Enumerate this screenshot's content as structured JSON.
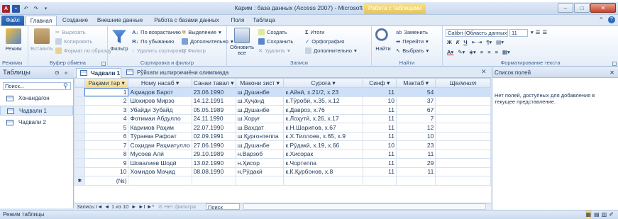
{
  "window": {
    "title": "Карим : база данных (Access 2007)  -  Microsoft Access",
    "context_tab": "Работа с таблицами"
  },
  "ribbon_tabs": [
    "Файл",
    "Главная",
    "Создание",
    "Внешние данные",
    "Работа с базами данных",
    "Поля",
    "Таблица"
  ],
  "ribbon": {
    "views": {
      "label": "Режимы",
      "button": "Режим"
    },
    "clipboard": {
      "label": "Буфер обмена",
      "paste": "Вставить",
      "cut": "Вырезать",
      "copy": "Копировать",
      "format_painter": "Формат по образцу"
    },
    "sort_filter": {
      "label": "Сортировка и фильтр",
      "filter": "Фильтр",
      "asc": "По возрастанию",
      "desc": "По убыванию",
      "remove_sort": "Удалить сортировку",
      "selection": "Выделение",
      "advanced": "Дополнительно",
      "toggle_filter": "Фильтр"
    },
    "records": {
      "label": "Записи",
      "refresh": "Обновить все",
      "new": "Создать",
      "save": "Сохранить",
      "delete": "Удалить",
      "totals": "Итоги",
      "spelling": "Орфография",
      "more": "Дополнительно"
    },
    "find": {
      "label": "Найти",
      "find": "Найти",
      "replace": "Заменить",
      "goto": "Перейти",
      "select": "Выбрать"
    },
    "text_format": {
      "label": "Форматирование текста",
      "font": "Calibri (Область данных",
      "size": "11",
      "bold": "Ж",
      "italic": "К",
      "underline": "Ч"
    }
  },
  "nav": {
    "title": "Таблицы",
    "search_placeholder": "Поиск...",
    "items": [
      "Хонандагон",
      "Чадвали 1",
      "Чадвали 2"
    ],
    "selected_index": 1
  },
  "doc_tabs": [
    {
      "label": "Чадвали 1",
      "active": true
    },
    {
      "label": "Рўйхати иштирокчиёни олимпиада",
      "active": false
    }
  ],
  "grid": {
    "columns": [
      "Рақами тар",
      "Ному насаб",
      "Санаи тавал",
      "Макони зист",
      "Суроға",
      "Синф",
      "Мактаб",
      "Щелкнит"
    ],
    "rows": [
      [
        "1",
        "Аҳмадов Барот",
        "23.06.1990",
        "ш.Душанбе",
        "к.Айнӣ, х.21/2, х.23",
        "11",
        "54"
      ],
      [
        "2",
        "Шокиров Мирзо",
        "14.12.1991",
        "ш.Хуҷанд",
        "к.Тӯробӣ, х.35, х.12",
        "10",
        "37"
      ],
      [
        "3",
        "Убайди Зубайд",
        "05.05.1989",
        "ш.Душанбе",
        "к.Даврoз, х.76",
        "11",
        "67"
      ],
      [
        "4",
        "Фотимаи Абдулло",
        "24.11.1990",
        "ш.Хоруғ",
        "к.Лоҳутӣ, х.26, х.17",
        "11",
        "7"
      ],
      [
        "5",
        "Каримов Раҳим",
        "22.07.1990",
        "ш.Вахдат",
        "к.Н.Шарипов, х.67",
        "11",
        "12"
      ],
      [
        "6",
        "Тӯраева Рафоат",
        "02.09.1991",
        "ш.Қурғонтеппа",
        "к.Х.Тиллоев, х.65, х.9",
        "11",
        "10"
      ],
      [
        "7",
        "Соҳидаи Раҳматулло",
        "27.06.1990",
        "ш.Душанбе",
        "к.Рӯдакӣ, х.19, х.66",
        "10",
        "23"
      ],
      [
        "8",
        "Мусоев Алӣ",
        "29.10.1989",
        "н.Варзоб",
        "к.Хисорак",
        "11",
        "11"
      ],
      [
        "9",
        "Шовалиев Шодӣ",
        "13.02.1990",
        "н.Ҳисор",
        "к.Чортеппа",
        "11",
        "29"
      ],
      [
        "10",
        "Хомидов Маҷид",
        "08.08.1990",
        "н.Рӯдакӣ",
        "к.К.Қурбонов, х.8",
        "11",
        "11"
      ]
    ],
    "new_row": "(№)"
  },
  "record_nav": {
    "label": "Запись:",
    "position": "1 из 10",
    "filter": "Нет фильтра",
    "search": "Поиск"
  },
  "status": "Режим таблицы",
  "field_list": {
    "title": "Список полей",
    "message": "Нет полей, доступных для добавления в текущее представление."
  }
}
